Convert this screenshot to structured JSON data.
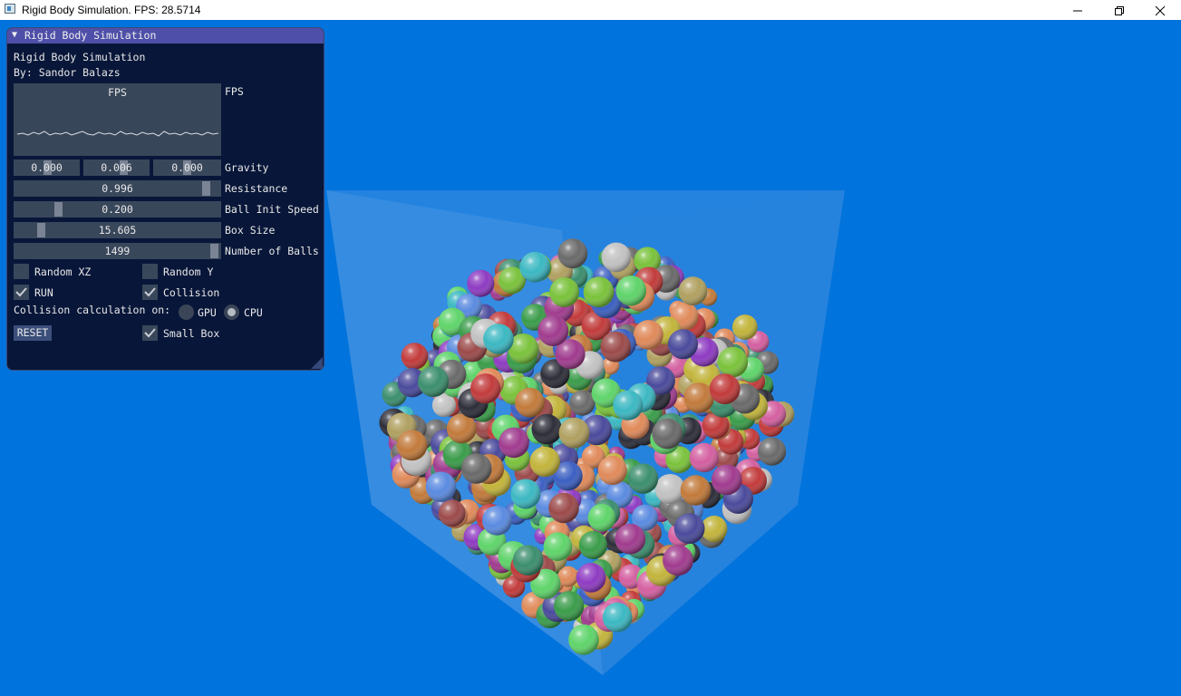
{
  "window": {
    "title": "Rigid Body Simulation. FPS: 28.5714",
    "controls": [
      "minimize-icon",
      "restore-icon",
      "close-icon"
    ]
  },
  "panel": {
    "header": "Rigid Body Simulation",
    "app_name": "Rigid Body Simulation",
    "author": "By: Sandor Balazs",
    "plot": {
      "title": "FPS",
      "label": "FPS"
    },
    "gravity": {
      "x": "0.000",
      "y": "0.006",
      "z": "0.000",
      "label": "Gravity"
    },
    "resistance": {
      "value": "0.996",
      "label": "Resistance",
      "fraction": 0.99
    },
    "ball_init_speed": {
      "value": "0.200",
      "label": "Ball Init Speed",
      "fraction": 0.2
    },
    "box_size": {
      "value": "15.605",
      "label": "Box Size",
      "fraction": 0.12
    },
    "number_of_balls": {
      "value": "1499",
      "label": "Number of Balls",
      "fraction": 1.0
    },
    "random_xz": {
      "label": "Random XZ",
      "checked": false
    },
    "random_y": {
      "label": "Random Y",
      "checked": false
    },
    "run": {
      "label": "RUN",
      "checked": true
    },
    "collision": {
      "label": "Collision",
      "checked": true
    },
    "collision_calc": {
      "label": "Collision calculation on:",
      "options": [
        "GPU",
        "CPU"
      ],
      "selected": "CPU"
    },
    "reset_label": "RESET",
    "small_box": {
      "label": "Small Box",
      "checked": true
    }
  },
  "colors": {
    "background": "#0173dc",
    "panel_bg": "#081434",
    "panel_header": "#4e4fa8",
    "widget_bg": "#39475b"
  }
}
